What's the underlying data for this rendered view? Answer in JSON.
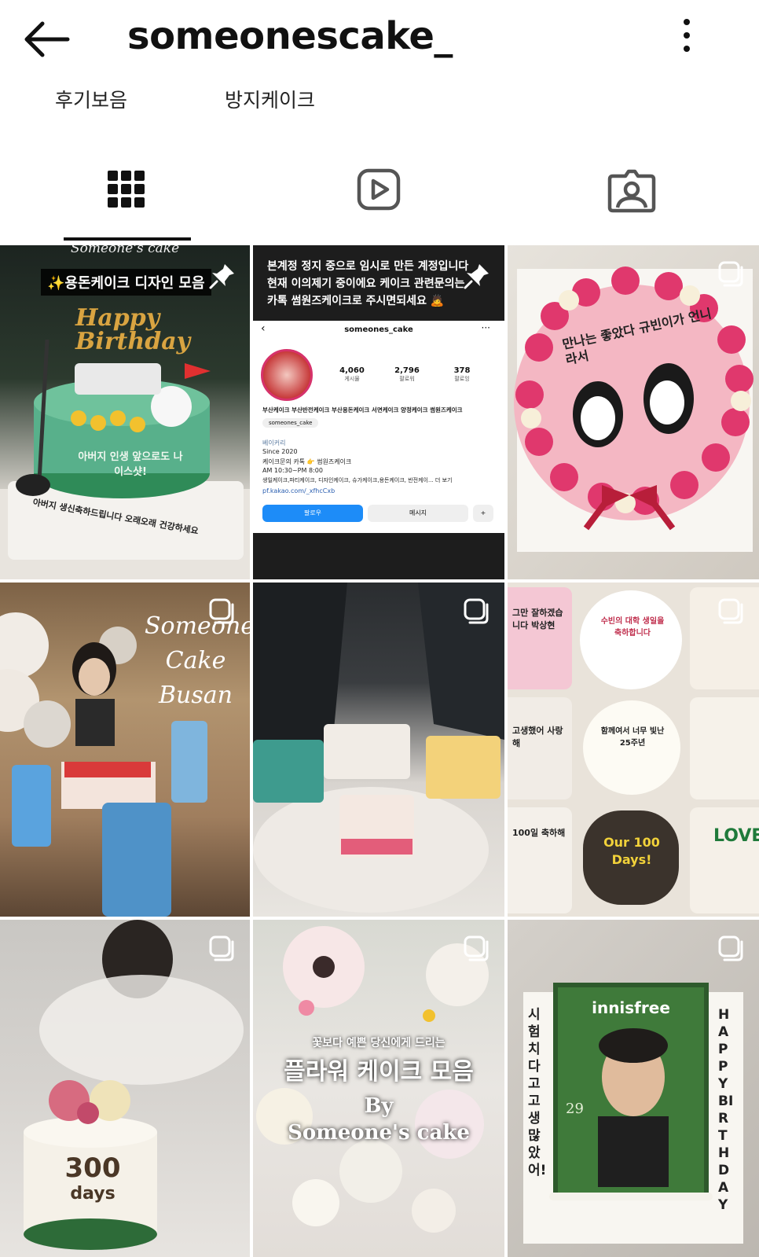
{
  "header": {
    "title": "someonescake_"
  },
  "highlights": [
    {
      "label": "후기보음"
    },
    {
      "label": "방지케이크"
    }
  ],
  "tabs": [
    {
      "name": "posts-grid",
      "active": true
    },
    {
      "name": "reels",
      "active": false
    },
    {
      "name": "tagged",
      "active": false
    }
  ],
  "posts": [
    {
      "caption": "✨용돈케이크 디자인 모음",
      "overlay_top": "Someone's cake",
      "cake_topper": "Happy Birthday",
      "cake_message": "아버지 인생 앞으로도 나이스샷!",
      "board_message": "아버지 생신축하드립니다 오래오래 건강하세요",
      "pinned": true
    },
    {
      "caption_lines": [
        "본계정 정지 중으로 임시로 만든 계정입니다",
        "현재 이의제기 중이에요 케이크 관련문의는",
        "카톡 썸원즈케이크로 주시면되세요 🙇"
      ],
      "pinned": true,
      "mock_profile": {
        "username": "someones_cake",
        "stats": [
          {
            "value": "4,060",
            "label": "게시물"
          },
          {
            "value": "2,796",
            "label": "팔로워"
          },
          {
            "value": "378",
            "label": "팔로잉"
          }
        ],
        "bio_title": "부산케이크 부산반전케이크 부산용돈케이크 서면케이크 양정케이크 썸원즈케이크",
        "threads_handle": "someones_cake",
        "category": "베이커리",
        "bio_lines": [
          "Since 2020",
          "케이크문의 카톡 👉 썸원즈케이크",
          "AM 10:30~PM 8:00",
          "생일케이크,파티케이크, 디자인케이크, 슈가케이크,용돈케이크, 반전케이... 더 보기"
        ],
        "link": "pf.kakao.com/_xfhcCxb",
        "follow_button": "팔로우",
        "message_button": "메시지"
      }
    },
    {
      "cake_message": "만나는 좋았다 규빈이가 언니라서",
      "multi": true
    },
    {
      "overlay_lines": [
        "Someone",
        "Cake",
        "Busan"
      ],
      "multi": true
    },
    {
      "multi": true
    },
    {
      "mini_cakes": [
        "그만 잘하겠습니다 박상현",
        "수빈의 대학 생일을 축하합니다",
        "",
        "고생했어 사랑해",
        "함께여서 너무 빛난 25주년",
        "",
        "100일 축하해",
        "Our 100 Days!",
        "LOVE"
      ],
      "multi": true
    },
    {
      "cake_message_top": "300",
      "cake_message_bottom": "days",
      "multi": true
    },
    {
      "overlay_small": "꽃보다 예쁜 당신에게 드리는",
      "overlay_big": "플라워 케이크 모음",
      "overlay_by": "By",
      "overlay_brand": "Someone's cake",
      "multi": true
    },
    {
      "brand": "innisfree",
      "side_left": "시험 치다고 고생 많았어!",
      "side_right": "HAPPY BIRTHDAY",
      "number": "29",
      "multi": true
    }
  ],
  "colors": {
    "accent_blue": "#1d8cf8",
    "text": "#111111"
  }
}
